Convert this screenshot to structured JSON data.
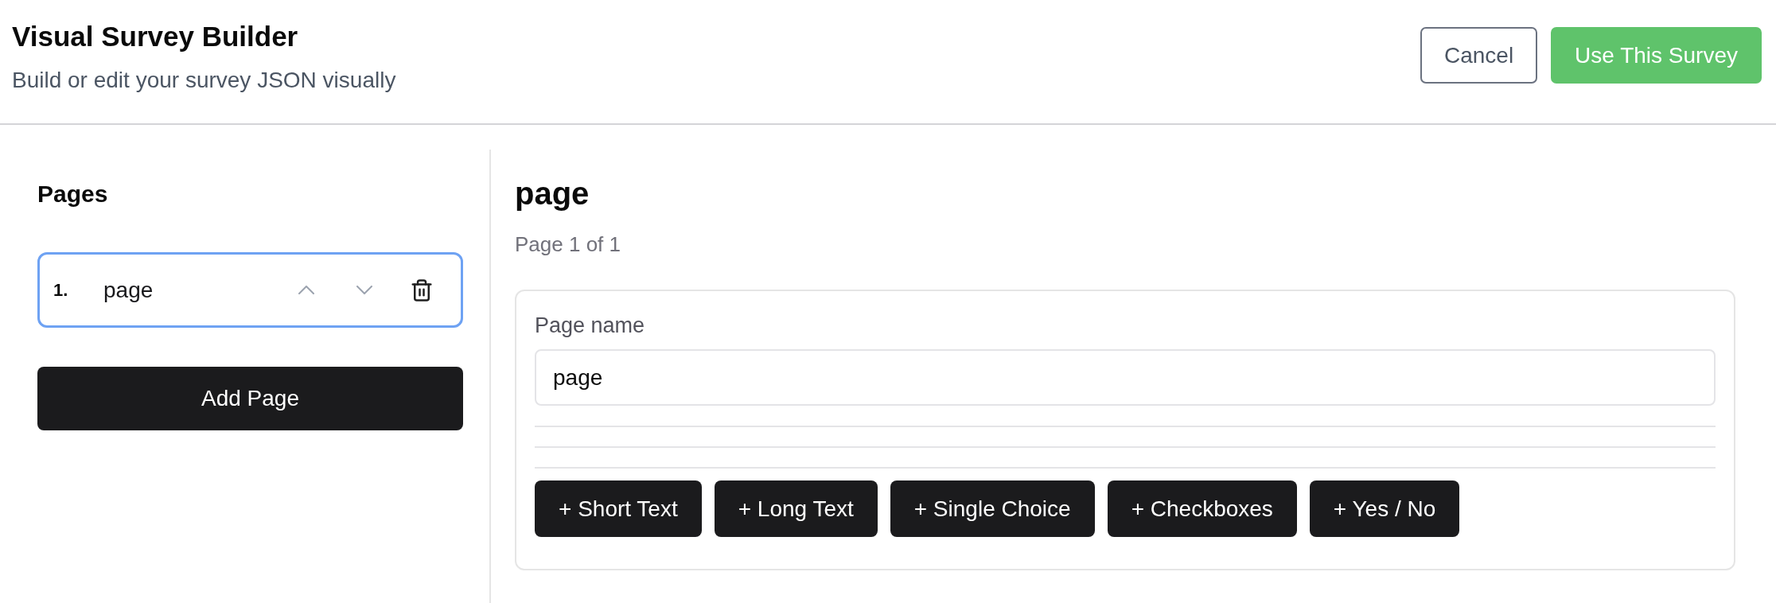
{
  "header": {
    "title": "Visual Survey Builder",
    "subtitle": "Build or edit your survey JSON visually",
    "actions": [
      {
        "label": "Cancel",
        "kind": "outline"
      },
      {
        "label": "Use This Survey",
        "kind": "primary"
      }
    ]
  },
  "sidebar": {
    "title": "Pages",
    "pages": [
      {
        "number": "1.",
        "name": "page",
        "selected": true,
        "move_up_disabled": true,
        "move_down_disabled": true
      }
    ],
    "add_button": "Add Page"
  },
  "editor": {
    "title": "page",
    "subtitle": "Page 1 of 1",
    "page_name": {
      "label": "Page name",
      "value": "page"
    },
    "add_buttons": [
      "+ Short Text",
      "+ Long Text",
      "+ Single Choice",
      "+ Checkboxes",
      "+ Yes / No"
    ]
  }
}
